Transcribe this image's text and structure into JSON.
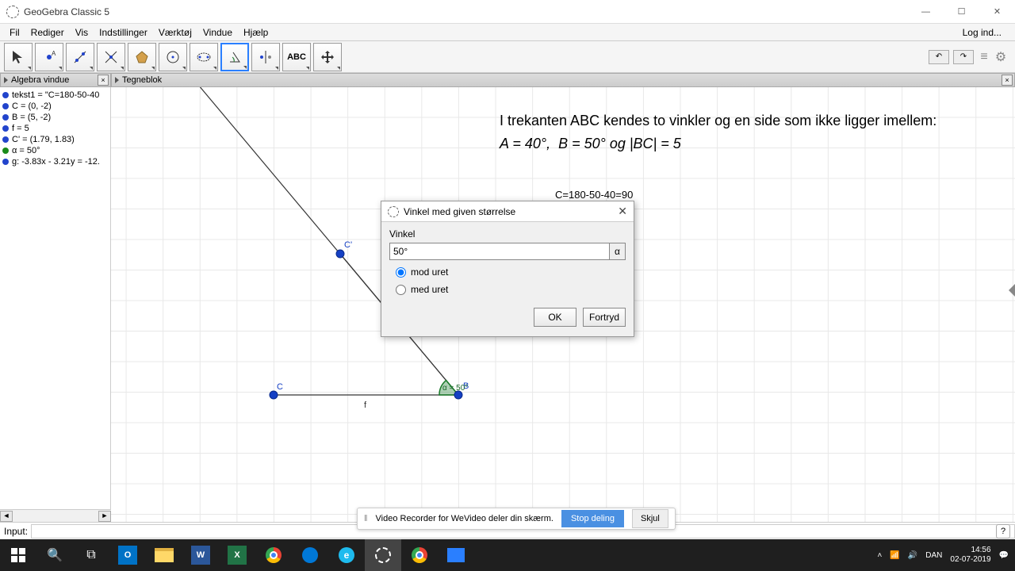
{
  "window": {
    "title": "GeoGebra Classic 5"
  },
  "menu": {
    "items": [
      "Fil",
      "Rediger",
      "Vis",
      "Indstillinger",
      "Værktøj",
      "Vindue",
      "Hjælp"
    ],
    "login": "Log ind..."
  },
  "panels": {
    "algebra": "Algebra vindue",
    "graphics": "Tegneblok"
  },
  "algebra": {
    "items": [
      {
        "color": "blue",
        "text": "tekst1 = \"C=180-50-40"
      },
      {
        "color": "blue",
        "text": "C = (0, -2)"
      },
      {
        "color": "blue",
        "text": "B = (5, -2)"
      },
      {
        "color": "blue",
        "text": "f = 5"
      },
      {
        "color": "blue",
        "text": "C' = (1.79, 1.83)"
      },
      {
        "color": "green",
        "text": "α = 50°"
      },
      {
        "color": "blue",
        "text": "g: -3.83x - 3.21y = -12."
      }
    ]
  },
  "problem": {
    "line1": "I trekanten ABC kendes to vinkler og en side som ikke ligger imellem:",
    "line2": "A = 40°,  B = 50° og |BC| = 5"
  },
  "calc": "C=180-50-40=90",
  "dialog": {
    "title": "Vinkel med given størrelse",
    "label": "Vinkel",
    "value": "50°",
    "opt1": "mod uret",
    "opt2": "med uret",
    "ok": "OK",
    "cancel": "Fortryd",
    "symbol": "α"
  },
  "input": {
    "label": "Input:"
  },
  "recorder": {
    "text": "Video Recorder for WeVideo deler din skærm.",
    "stop": "Stop deling",
    "hide": "Skjul"
  },
  "tray": {
    "lang": "DAN",
    "time": "14:56",
    "date": "02-07-2019"
  },
  "labels": {
    "C": "C",
    "B": "B",
    "Cp": "C'",
    "f": "f",
    "ang": "α = 50°"
  }
}
